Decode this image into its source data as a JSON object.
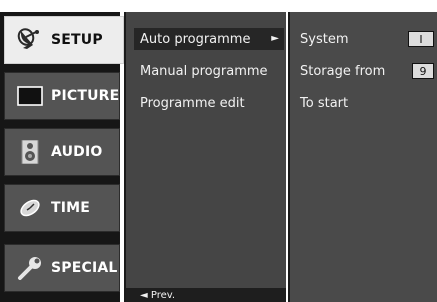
{
  "categories": [
    {
      "label": "SETUP",
      "icon": "satellite-dish-icon"
    },
    {
      "label": "PICTURE",
      "icon": "tv-screen-icon"
    },
    {
      "label": "AUDIO",
      "icon": "speaker-icon"
    },
    {
      "label": "TIME",
      "icon": "clock-icon"
    },
    {
      "label": "SPECIAL",
      "icon": "wrench-icon"
    }
  ],
  "menu": {
    "items": [
      "Auto programme",
      "Manual programme",
      "Programme edit"
    ],
    "selected_arrow": "►",
    "prev_label": "◄ Prev."
  },
  "submenu": {
    "system_label": "System",
    "system_value": "I",
    "storage_label": "Storage from",
    "storage_value": "9",
    "start_label": "To start"
  },
  "colors": {
    "active_category": "#ededed",
    "category_bg": "#545454",
    "menu_bg": "#454545"
  }
}
